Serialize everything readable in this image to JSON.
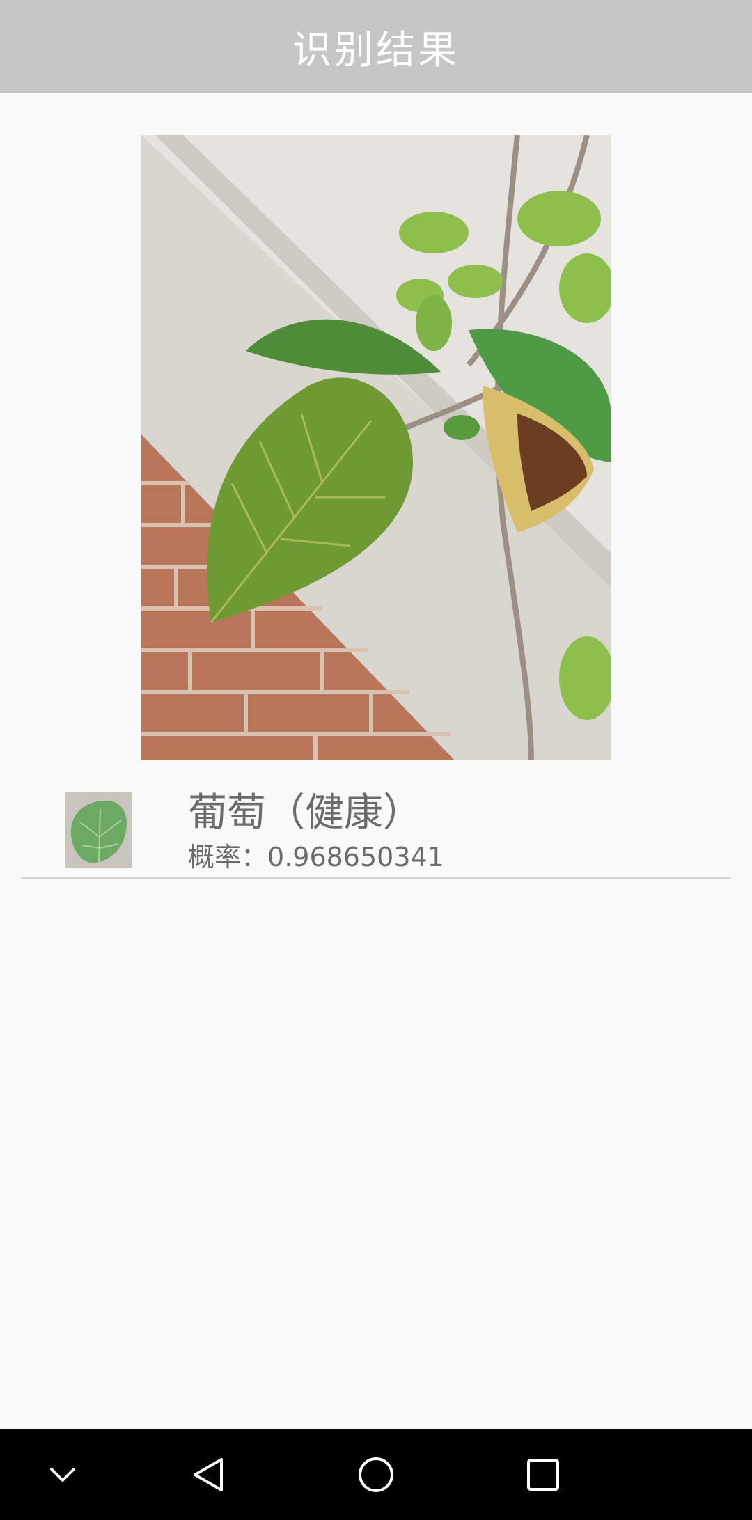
{
  "header": {
    "title": "识别结果"
  },
  "result": {
    "name": "葡萄（健康）",
    "probability_label": "概率：",
    "probability_value": "0.968650341"
  },
  "nav": {
    "icons": [
      "chevron-down-icon",
      "back-triangle-icon",
      "home-circle-icon",
      "recents-square-icon"
    ]
  },
  "colors": {
    "app_bar": "#c6c6c6",
    "background": "#f9f9f9",
    "text": "#6b6b6b",
    "nav_bar": "#000000"
  }
}
